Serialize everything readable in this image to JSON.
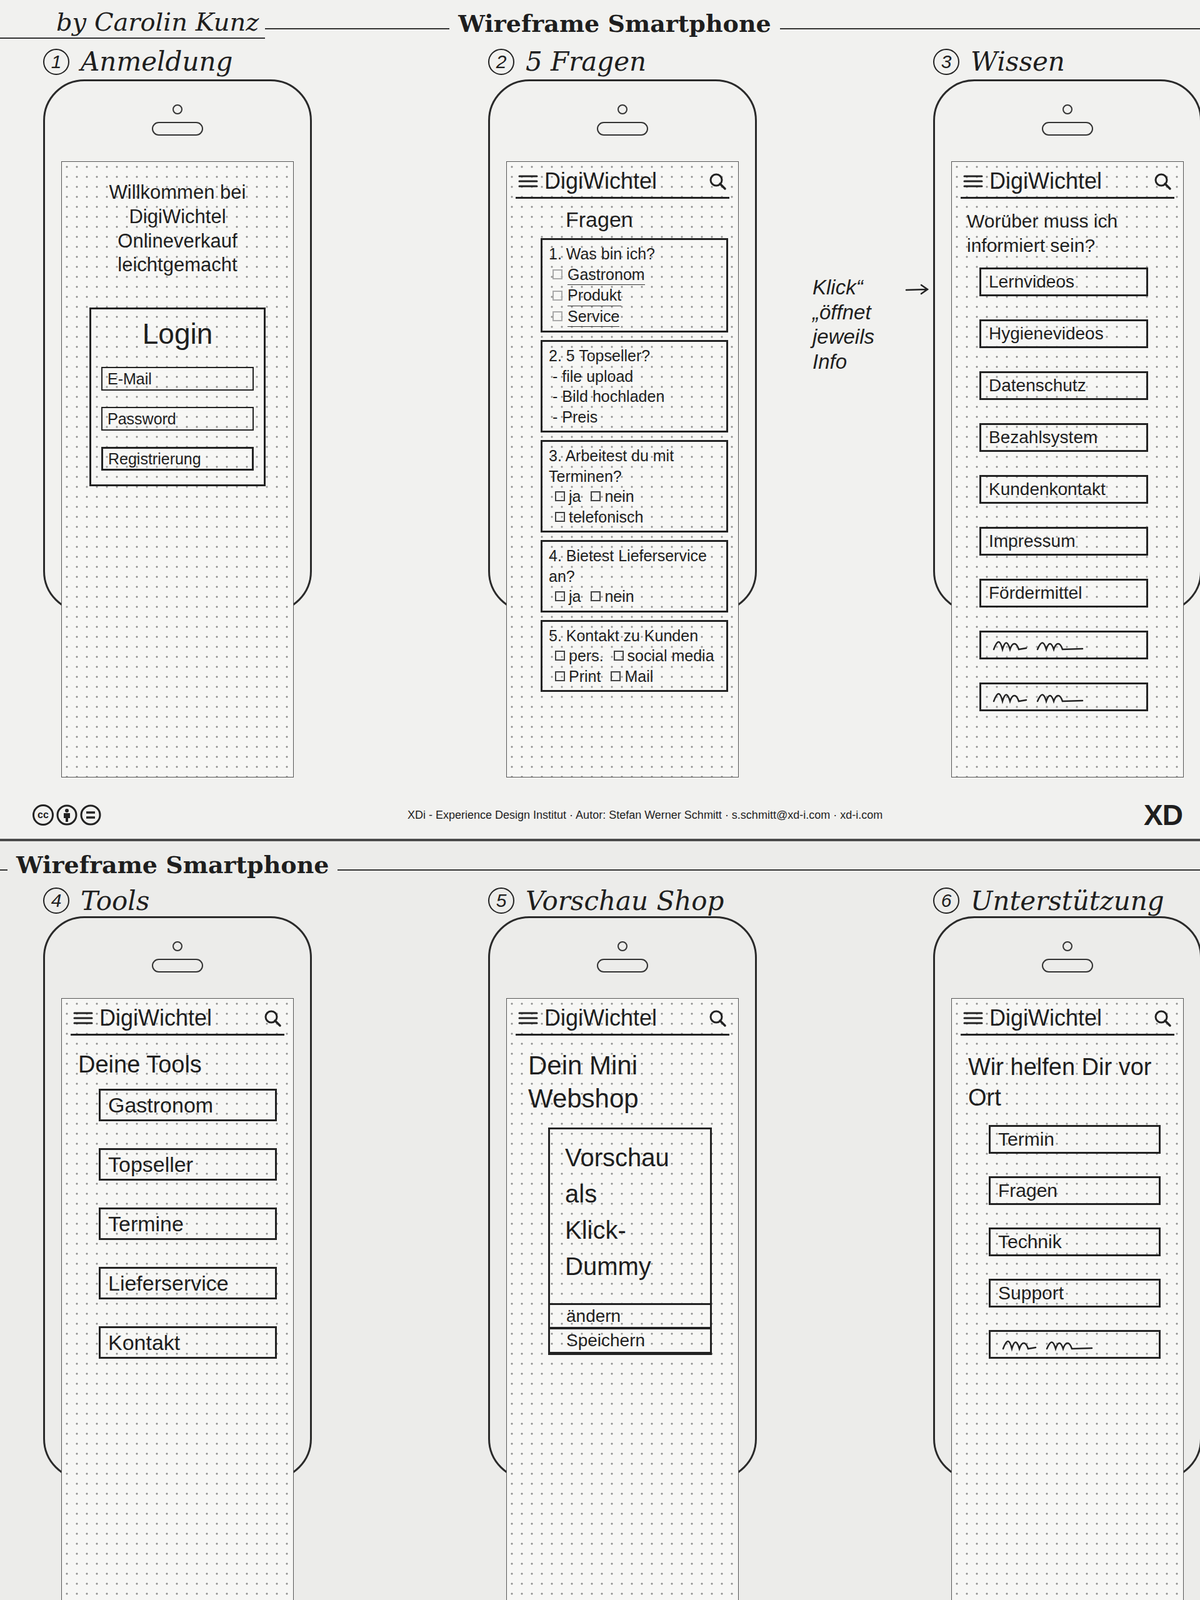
{
  "sheets": [
    {
      "author": "by Carolin Kunz",
      "title": "Wireframe Smartphone",
      "screens": [
        {
          "number": "1",
          "label": "Anmeldung",
          "kind": "login",
          "welcome": [
            "Willkommen bei",
            "DigiWichtel",
            "Onlineverkauf",
            "leichtgemacht"
          ],
          "login": {
            "title": "Login",
            "fields": [
              "E-Mail",
              "Password"
            ],
            "button": "Registrierung"
          }
        },
        {
          "number": "2",
          "label": "5 Fragen",
          "kind": "questions",
          "app_title": "DigiWichtel",
          "heading": "Fragen",
          "questions": [
            {
              "title": "1. Was bin ich?",
              "kind": "checklist",
              "options": [
                {
                  "label": "Gastronom",
                  "checked": false
                },
                {
                  "label": "Produkt",
                  "checked": false
                },
                {
                  "label": "Service",
                  "checked": false
                }
              ]
            },
            {
              "title": "2. 5 Topseller?",
              "kind": "bullets",
              "items": [
                "- file upload",
                "- Bild hochladen",
                "- Preis"
              ]
            },
            {
              "title": "3. Arbeitest du mit Terminen?",
              "kind": "choices",
              "options": [
                {
                  "label": "ja",
                  "checked": false
                },
                {
                  "label": "nein",
                  "checked": false
                },
                {
                  "label": "telefonisch",
                  "checked": false
                }
              ]
            },
            {
              "title": "4. Bietest Lieferservice an?",
              "kind": "choices",
              "options": [
                {
                  "label": "ja",
                  "checked": false
                },
                {
                  "label": "nein",
                  "checked": false
                }
              ]
            },
            {
              "title": "5. Kontakt zu Kunden",
              "kind": "choices",
              "options": [
                {
                  "label": "pers.",
                  "checked": false
                },
                {
                  "label": "social media",
                  "checked": false
                },
                {
                  "label": "Print",
                  "checked": false
                },
                {
                  "label": "Mail",
                  "checked": false
                }
              ]
            }
          ]
        },
        {
          "number": "3",
          "label": "Wissen",
          "kind": "menu",
          "app_title": "DigiWichtel",
          "heading": "Worüber muss ich informiert sein?",
          "buttons": [
            {
              "kind": "label",
              "label": "Lernvideos"
            },
            {
              "kind": "label",
              "label": "Hygienevideos"
            },
            {
              "kind": "label",
              "label": "Datenschutz"
            },
            {
              "kind": "label",
              "label": "Bezahlsystem"
            },
            {
              "kind": "label",
              "label": "Kundenkontakt"
            },
            {
              "kind": "label",
              "label": "Impressum"
            },
            {
              "kind": "label",
              "label": "Fördermittel"
            },
            {
              "kind": "scribble"
            },
            {
              "kind": "scribble"
            }
          ]
        }
      ],
      "annotation": [
        "Klick“",
        "„öffnet",
        "jeweils",
        "Info"
      ],
      "footer": {
        "license": "cc",
        "credit": "XDi - Experience Design Institut · Autor: Stefan Werner Schmitt · s.schmitt@xd-i.com · xd-i.com",
        "logo": "XD"
      }
    },
    {
      "title": "Wireframe Smartphone",
      "screens": [
        {
          "number": "4",
          "label": "Tools",
          "kind": "menu",
          "app_title": "DigiWichtel",
          "heading": "Deine Tools",
          "buttons": [
            {
              "kind": "label",
              "label": "Gastronom"
            },
            {
              "kind": "label",
              "label": "Topseller"
            },
            {
              "kind": "label",
              "label": "Termine"
            },
            {
              "kind": "label",
              "label": "Lieferservice"
            },
            {
              "kind": "label",
              "label": "Kontakt"
            }
          ]
        },
        {
          "number": "5",
          "label": "Vorschau Shop",
          "kind": "preview",
          "app_title": "DigiWichtel",
          "heading": "Dein Mini Webshop",
          "preview": [
            "Vorschau",
            "als",
            "Klick-",
            "Dummy"
          ],
          "actions": [
            "ändern",
            "Speichern"
          ]
        },
        {
          "number": "6",
          "label": "Unterstützung",
          "kind": "menu",
          "app_title": "DigiWichtel",
          "heading": "Wir helfen Dir vor Ort",
          "buttons": [
            {
              "kind": "label",
              "label": "Termin"
            },
            {
              "kind": "label",
              "label": "Fragen"
            },
            {
              "kind": "label",
              "label": "Technik"
            },
            {
              "kind": "label",
              "label": "Support"
            },
            {
              "kind": "scribble"
            }
          ]
        }
      ]
    }
  ]
}
